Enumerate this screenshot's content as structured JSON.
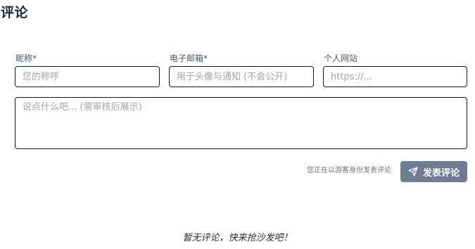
{
  "section": {
    "title": "评论"
  },
  "form": {
    "nickname": {
      "label": "昵称*",
      "placeholder": "您的称呼",
      "value": ""
    },
    "email": {
      "label": "电子邮箱*",
      "placeholder": "用于头像与通知 (不会公开)",
      "value": ""
    },
    "website": {
      "label": "个人网站",
      "placeholder": "https://...",
      "value": ""
    },
    "comment": {
      "placeholder": "说点什么吧... (需审核后展示)",
      "value": ""
    },
    "guest_note": "您正在以游客身份发表评论",
    "submit_label": "发表评论",
    "submit_icon": "send-icon"
  },
  "comments": {
    "empty_text": "暂无评论，快来抢沙发吧！"
  },
  "colors": {
    "input_border": "#111827",
    "button_bg": "#6e7d92",
    "placeholder": "#a0a4ab"
  }
}
